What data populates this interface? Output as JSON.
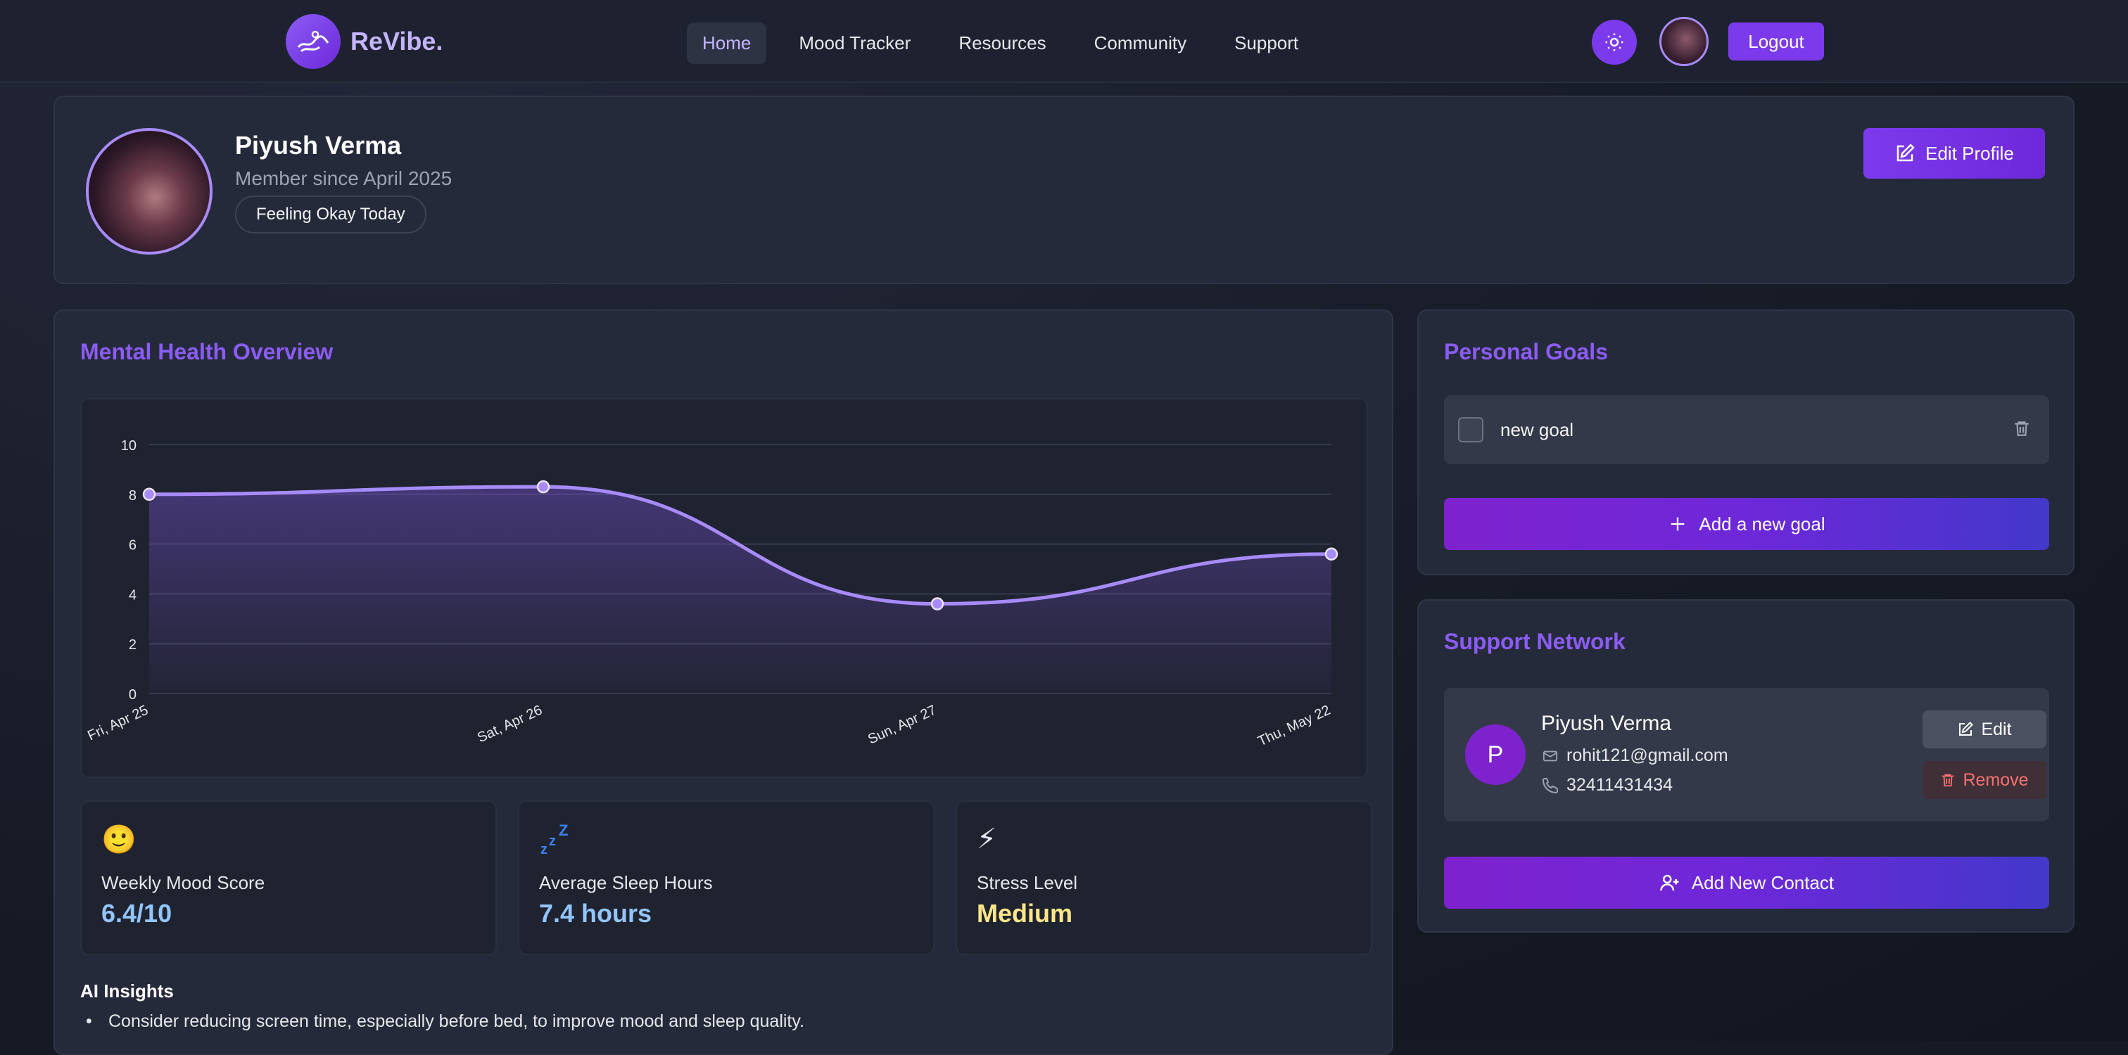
{
  "nav": {
    "brand": "ReVibe.",
    "links": [
      "Home",
      "Mood Tracker",
      "Resources",
      "Community",
      "Support"
    ],
    "active": "Home",
    "logout_label": "Logout",
    "theme_icon": "sun-icon"
  },
  "profile": {
    "name": "Piyush Verma",
    "member_since": "Member since April 2025",
    "mood_status": "Feeling Okay Today",
    "edit_label": "Edit Profile"
  },
  "overview": {
    "title": "Mental Health Overview",
    "stats": [
      {
        "icon": "slightly-smiling-face-emoji",
        "glyph": "🙂",
        "label": "Weekly Mood Score",
        "value": "6.4/10",
        "color": "#93c5fd"
      },
      {
        "icon": "zzz-icon",
        "glyph": "ᶻᶻᶻ",
        "label": "Average Sleep Hours",
        "value": "7.4 hours",
        "color": "#93c5fd"
      },
      {
        "icon": "lightning-icon",
        "glyph": "⚡",
        "label": "Stress Level",
        "value": "Medium",
        "color": "#fde68a"
      }
    ],
    "insights_title": "AI Insights",
    "insights": [
      "Consider reducing screen time, especially before bed, to improve mood and sleep quality."
    ]
  },
  "chart_data": {
    "type": "area",
    "categories": [
      "Fri, Apr 25",
      "Sat, Apr 26",
      "Sun, Apr 27",
      "Thu, May 22"
    ],
    "series": [
      {
        "values": [
          8.0,
          8.3,
          3.6,
          5.6
        ]
      }
    ],
    "ylim": [
      0,
      10
    ],
    "yticks": [
      0,
      2,
      4,
      6,
      8,
      10
    ],
    "grid": true,
    "line_color": "#a78bfa"
  },
  "goals": {
    "title": "Personal Goals",
    "items": [
      {
        "text": "new goal",
        "done": false
      }
    ],
    "add_label": "Add a new goal"
  },
  "support": {
    "title": "Support Network",
    "contacts": [
      {
        "initial": "P",
        "name": "Piyush Verma",
        "email": "rohit121@gmail.com",
        "phone": "32411431434"
      }
    ],
    "edit_label": "Edit",
    "remove_label": "Remove",
    "add_label": "Add New Contact"
  }
}
